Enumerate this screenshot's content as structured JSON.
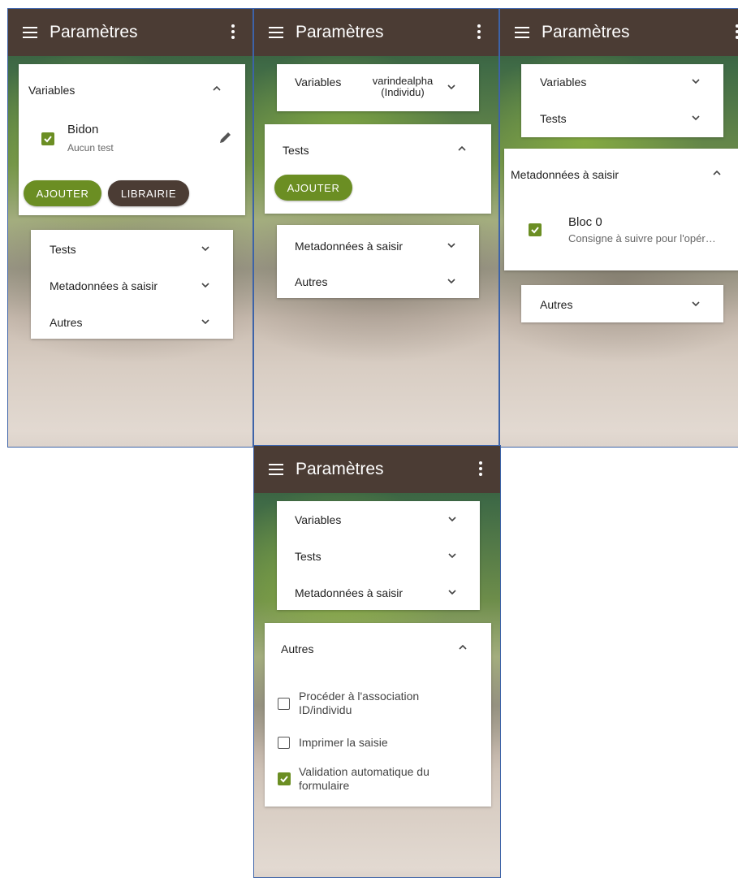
{
  "app": {
    "title": "Paramètres"
  },
  "sections": {
    "variables": "Variables",
    "tests": "Tests",
    "metadonnees": "Metadonnées à saisir",
    "autres": "Autres"
  },
  "screen1": {
    "variable_item": {
      "name": "Bidon",
      "subtitle": "Aucun test",
      "checked": true
    },
    "buttons": {
      "ajouter": "AJOUTER",
      "librairie": "LIBRAIRIE"
    }
  },
  "screen2": {
    "variables_value": "varindealpha (Individu)",
    "buttons": {
      "ajouter": "AJOUTER"
    }
  },
  "screen3": {
    "bloc_item": {
      "name": "Bloc 0",
      "subtitle": "Consigne à suivre pour l'opér…",
      "checked": true
    }
  },
  "screen4": {
    "options": [
      {
        "label": "Procéder à l'association ID/individu",
        "checked": false
      },
      {
        "label": "Imprimer la saisie",
        "checked": false
      },
      {
        "label": "Validation automatique du formulaire",
        "checked": true
      }
    ]
  },
  "colors": {
    "appbar": "#4b3c34",
    "accent_green": "#6b8e23",
    "frame_border": "#3d63a8"
  },
  "icons": [
    "menu-icon",
    "more-vert-icon",
    "chevron-up-icon",
    "chevron-down-icon",
    "edit-pencil-icon",
    "checkbox-checked-icon",
    "checkbox-unchecked-icon"
  ]
}
